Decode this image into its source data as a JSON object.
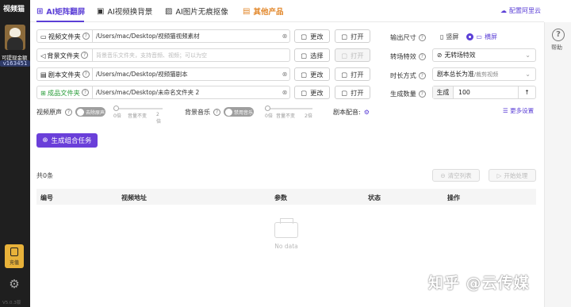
{
  "sidebar": {
    "app_name": "视频猫",
    "vip_text": "可提现金额",
    "user_id": "v163451",
    "recharge_label": "充值",
    "version": "V5.0.3版",
    "settings_icon": "gear-icon"
  },
  "tabs": [
    {
      "label": "AI矩阵翻屏",
      "icon": "grid-icon"
    },
    {
      "label": "AI视频换背景",
      "icon": "image-icon"
    },
    {
      "label": "AI图片无痕抠像",
      "icon": "picture-icon"
    },
    {
      "label": "其他产品",
      "icon": "box-icon"
    }
  ],
  "cloud_link": "配置阿里云",
  "help": {
    "label": "帮助"
  },
  "folders": [
    {
      "label": "视频文件夹",
      "value": "/Users/mac/Desktop/视频猫视频素材",
      "btn1": "更改",
      "btn2": "打开"
    },
    {
      "label": "背景文件夹",
      "value": "",
      "placeholder": "背景音乐文件夹，支持音频、视频；可以为空",
      "btn1": "选择",
      "btn2": "打开"
    },
    {
      "label": "剧本文件夹",
      "value": "/Users/mac/Desktop/视频猫剧本",
      "btn1": "更改",
      "btn2": "打开"
    },
    {
      "label": "成品文件夹",
      "value": "/Users/mac/Desktop/未命名文件夹 2",
      "btn1": "更改",
      "btn2": "打开"
    }
  ],
  "settings": {
    "output_size_label": "输出尺寸",
    "portrait": "竖屏",
    "landscape": "横屏",
    "transition_label": "转场特效",
    "transition_value": "无转场特效",
    "duration_label": "时长方式",
    "duration_value": "剧本总长为准",
    "duration_sub": "/裁剪视频",
    "quantity_label": "生成数量",
    "quantity_prefix": "生成",
    "quantity_value": "100"
  },
  "audio": {
    "video_sound_label": "视频原声",
    "video_sound_toggle": "去除原声",
    "video_ticks": [
      "0倍",
      "音量不变",
      "2倍"
    ],
    "bg_music_label": "背景音乐",
    "bg_music_toggle": "禁用音乐",
    "bg_ticks": [
      "0倍",
      "音量不变",
      "2倍"
    ],
    "dub_label": "剧本配音:",
    "more_settings": "更多设置"
  },
  "actions": {
    "generate": "生成组合任务",
    "count": "共0条",
    "clear": "清空列表",
    "start": "开始处理"
  },
  "table": {
    "headers": [
      "编号",
      "视频地址",
      "参数",
      "状态",
      "操作"
    ],
    "empty": "No data"
  },
  "watermark": "知乎 @云传媒",
  "colors": {
    "accent": "#5b3fd6",
    "other_tab": "#e2872a",
    "success": "#2a9d3a"
  }
}
